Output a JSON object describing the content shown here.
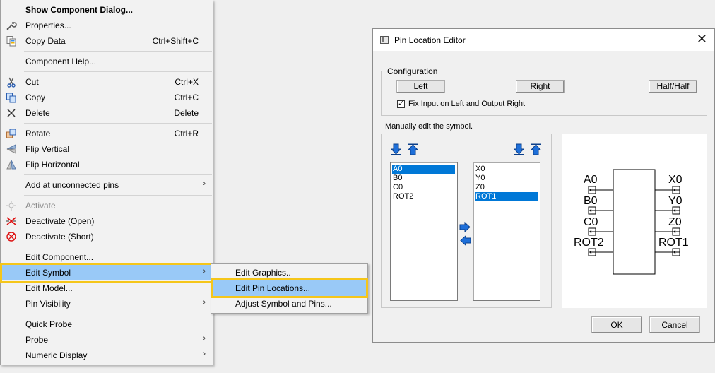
{
  "context_menu": {
    "items": [
      {
        "label": "Show Component Dialog...",
        "shortcut": ""
      },
      {
        "label": "Properties...",
        "shortcut": ""
      },
      {
        "label": "Copy Data",
        "shortcut": "Ctrl+Shift+C"
      },
      {
        "label": "Component Help...",
        "shortcut": ""
      },
      {
        "label": "Cut",
        "shortcut": "Ctrl+X"
      },
      {
        "label": "Copy",
        "shortcut": "Ctrl+C"
      },
      {
        "label": "Delete",
        "shortcut": "Delete"
      },
      {
        "label": "Rotate",
        "shortcut": "Ctrl+R"
      },
      {
        "label": "Flip Vertical",
        "shortcut": ""
      },
      {
        "label": "Flip Horizontal",
        "shortcut": ""
      },
      {
        "label": "Add at unconnected pins",
        "shortcut": ""
      },
      {
        "label": "Activate",
        "shortcut": ""
      },
      {
        "label": "Deactivate (Open)",
        "shortcut": ""
      },
      {
        "label": "Deactivate (Short)",
        "shortcut": ""
      },
      {
        "label": "Edit Component...",
        "shortcut": ""
      },
      {
        "label": "Edit Symbol",
        "shortcut": ""
      },
      {
        "label": "Edit Model...",
        "shortcut": ""
      },
      {
        "label": "Pin Visibility",
        "shortcut": ""
      },
      {
        "label": "Quick Probe",
        "shortcut": ""
      },
      {
        "label": "Probe",
        "shortcut": ""
      },
      {
        "label": "Numeric Display",
        "shortcut": ""
      }
    ],
    "submenu_arrow": "›"
  },
  "submenu": {
    "items": [
      {
        "label": "Edit Graphics.."
      },
      {
        "label": "Edit Pin Locations..."
      },
      {
        "label": "Adjust Symbol and Pins..."
      }
    ]
  },
  "dialog": {
    "title": "Pin Location Editor",
    "close": "✕",
    "config_group": "Configuration",
    "btn_left": "Left",
    "btn_right": "Right",
    "btn_halfhalf": "Half/Half",
    "fix_checkbox_label": "Fix Input on Left and Output Right",
    "fix_checked": true,
    "manual_label": "Manually edit the symbol.",
    "left_list": [
      "A0",
      "B0",
      "C0",
      "ROT2"
    ],
    "left_selected": "A0",
    "right_list": [
      "X0",
      "Y0",
      "Z0",
      "ROT1"
    ],
    "right_selected": "ROT1",
    "ok": "OK",
    "cancel": "Cancel",
    "preview": {
      "left_pins": [
        "A0",
        "B0",
        "C0",
        "ROT2"
      ],
      "right_pins": [
        "X0",
        "Y0",
        "Z0",
        "ROT1"
      ],
      "pin_arrow": "←"
    }
  },
  "colors": {
    "highlight": "#99c9f7",
    "list_selection": "#0078d7",
    "callout": "#f5c61a",
    "arrow_icon": "#1e6fd9"
  }
}
